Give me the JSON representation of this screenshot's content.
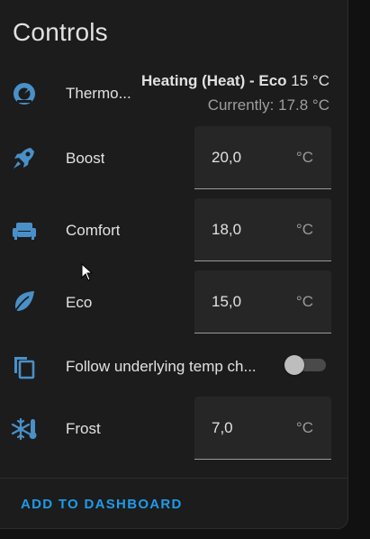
{
  "card": {
    "title": "Controls",
    "add_button_label": "ADD TO DASHBOARD"
  },
  "icon_color": "#4a90c8",
  "accent_color": "#1e9be9",
  "rows": {
    "thermostat": {
      "icon": "thermostat-icon",
      "label": "Thermo...",
      "state_bold": "Heating (Heat) - Eco",
      "state_temp": "15 °C",
      "current": "Currently: 17.8 °C"
    },
    "boost": {
      "icon": "rocket-icon",
      "label": "Boost",
      "value": "20,0",
      "unit": "°C"
    },
    "comfort": {
      "icon": "sofa-icon",
      "label": "Comfort",
      "value": "18,0",
      "unit": "°C"
    },
    "eco": {
      "icon": "leaf-icon",
      "label": "Eco",
      "value": "15,0",
      "unit": "°C"
    },
    "follow": {
      "icon": "copy-icon",
      "label": "Follow underlying temp ch...",
      "toggle_on": false
    },
    "frost": {
      "icon": "snowflake-thermometer-icon",
      "label": "Frost",
      "value": "7,0",
      "unit": "°C"
    }
  }
}
